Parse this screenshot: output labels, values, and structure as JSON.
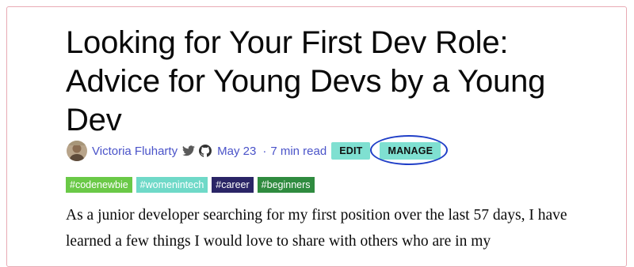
{
  "article": {
    "title": "Looking for Your First Dev Role: Advice for Young Devs by a Young Dev",
    "author": "Victoria Fluharty",
    "date": "May 23",
    "separator": "·",
    "read_time": "7 min read",
    "edit_label": "EDIT",
    "manage_label": "MANAGE",
    "tags": [
      {
        "label": "#codenewbie",
        "color": "#6ac947"
      },
      {
        "label": "#womenintech",
        "color": "#6fd9c8"
      },
      {
        "label": "#career",
        "color": "#2a2566"
      },
      {
        "label": "#beginners",
        "color": "#2f8b3f"
      }
    ],
    "body": "As a junior developer searching for my first position over the last 57 days, I have learned a few things I would love to share with others who are in my"
  },
  "icons": {
    "twitter": "twitter-icon",
    "github": "github-icon"
  },
  "colors": {
    "link": "#4a53c9",
    "button_bg": "#7fe0d1",
    "highlight_ring": "#1f3ec7",
    "frame_border": "#e8aab4"
  }
}
